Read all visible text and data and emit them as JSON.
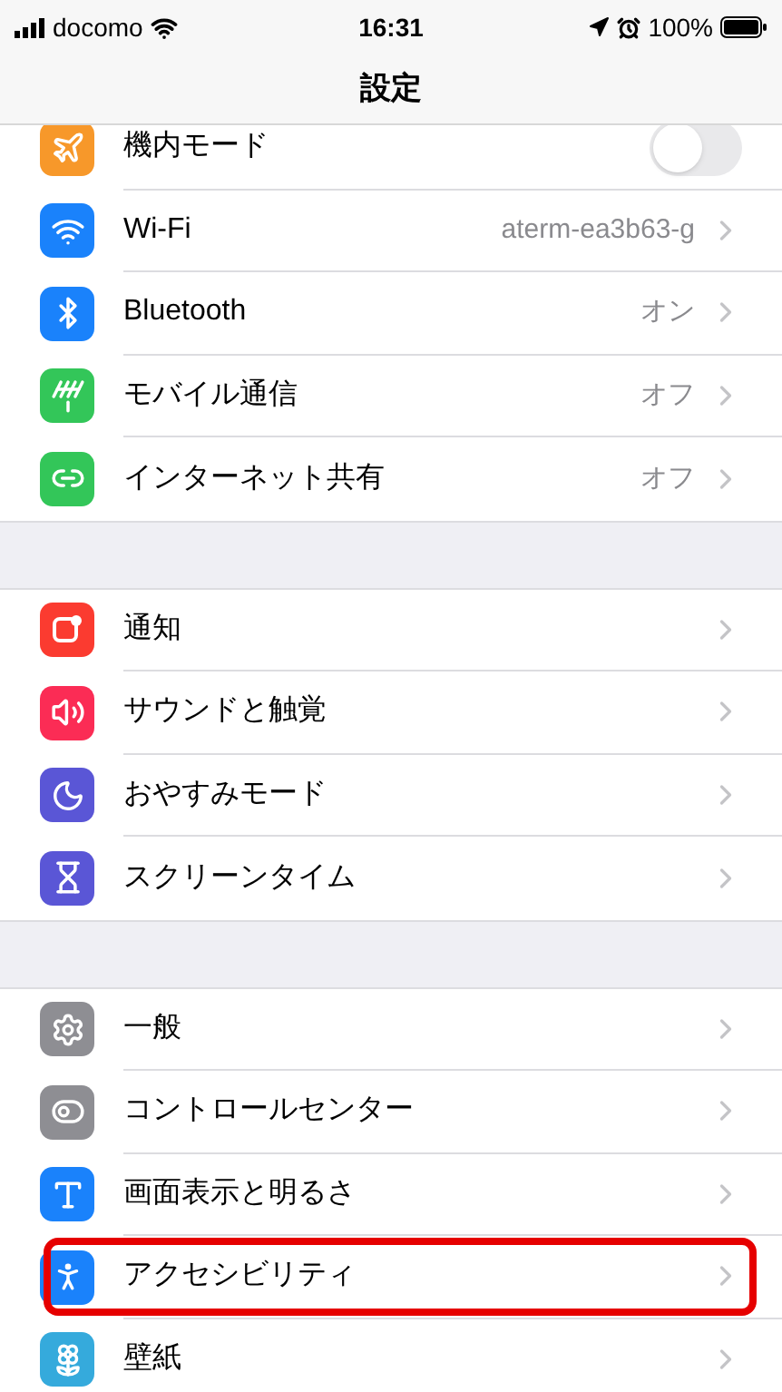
{
  "status_bar": {
    "carrier": "docomo",
    "time": "16:31",
    "battery": "100%"
  },
  "nav": {
    "title": "設定"
  },
  "groups": [
    {
      "items": [
        {
          "kind": "toggle",
          "label": "機内モード",
          "on": false,
          "highlighted": false
        },
        {
          "kind": "link",
          "label": "Wi-Fi",
          "value": "aterm-ea3b63-g",
          "highlighted": false
        },
        {
          "kind": "link",
          "label": "Bluetooth",
          "value": "オン",
          "highlighted": false
        },
        {
          "kind": "link",
          "label": "モバイル通信",
          "value": "オフ",
          "highlighted": false
        },
        {
          "kind": "link",
          "label": "インターネット共有",
          "value": "オフ",
          "highlighted": false
        }
      ]
    },
    {
      "items": [
        {
          "kind": "link",
          "label": "通知",
          "highlighted": false
        },
        {
          "kind": "link",
          "label": "サウンドと触覚",
          "highlighted": false
        },
        {
          "kind": "link",
          "label": "おやすみモード",
          "highlighted": false
        },
        {
          "kind": "link",
          "label": "スクリーンタイム",
          "highlighted": false
        }
      ]
    },
    {
      "items": [
        {
          "kind": "link",
          "label": "一般",
          "highlighted": false
        },
        {
          "kind": "link",
          "label": "コントロールセンター",
          "highlighted": false
        },
        {
          "kind": "link",
          "label": "画面表示と明るさ",
          "highlighted": false
        },
        {
          "kind": "link",
          "label": "アクセシビリティ",
          "highlighted": true
        },
        {
          "kind": "link",
          "label": "壁紙",
          "highlighted": false
        }
      ]
    }
  ]
}
